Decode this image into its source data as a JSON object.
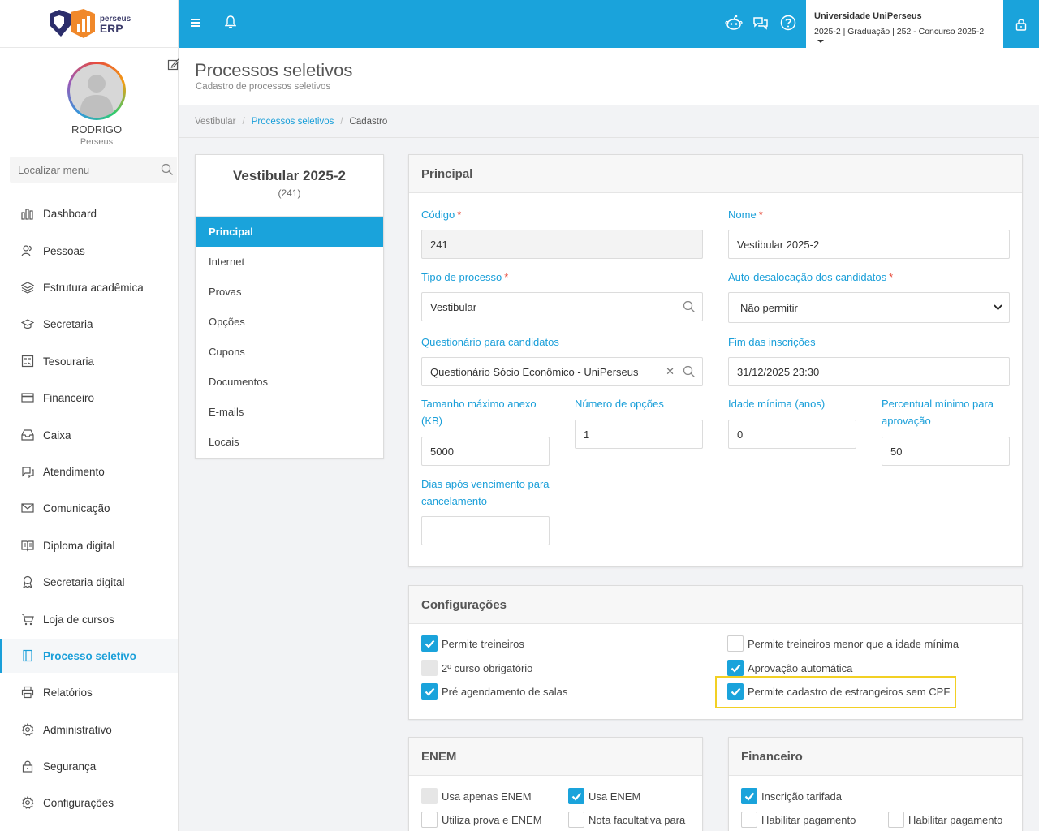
{
  "app": {
    "logo_line1": "perseus",
    "logo_line2": "ERP"
  },
  "user": {
    "name": "RODRIGO",
    "org": "Perseus"
  },
  "menu_search": {
    "placeholder": "Localizar menu"
  },
  "menu": [
    {
      "label": "Dashboard",
      "icon": "chart-icon"
    },
    {
      "label": "Pessoas",
      "icon": "people-icon"
    },
    {
      "label": "Estrutura acadêmica",
      "icon": "layers-icon"
    },
    {
      "label": "Secretaria",
      "icon": "graduation-cap-icon"
    },
    {
      "label": "Tesouraria",
      "icon": "calculator-icon"
    },
    {
      "label": "Financeiro",
      "icon": "credit-card-icon"
    },
    {
      "label": "Caixa",
      "icon": "inbox-icon"
    },
    {
      "label": "Atendimento",
      "icon": "chat-icon"
    },
    {
      "label": "Comunicação",
      "icon": "envelope-icon"
    },
    {
      "label": "Diploma digital",
      "icon": "book-icon"
    },
    {
      "label": "Secretaria digital",
      "icon": "award-icon"
    },
    {
      "label": "Loja de cursos",
      "icon": "cart-icon"
    },
    {
      "label": "Processo seletivo",
      "icon": "notebook-icon",
      "active": true
    },
    {
      "label": "Relatórios",
      "icon": "printer-icon"
    },
    {
      "label": "Administrativo",
      "icon": "gear-icon"
    },
    {
      "label": "Segurança",
      "icon": "lock-icon"
    },
    {
      "label": "Configurações",
      "icon": "gear-icon"
    }
  ],
  "institution": {
    "name": "Universidade UniPerseus",
    "context": "2025-2 | Graduação | 252 - Concurso 2025-2"
  },
  "header": {
    "title": "Processos seletivos",
    "subtitle": "Cadastro de processos seletivos"
  },
  "breadcrumb": [
    "Vestibular",
    "Processos seletivos",
    "Cadastro"
  ],
  "side_card": {
    "title": "Vestibular 2025-2",
    "code": "(241)",
    "tabs": [
      "Principal",
      "Internet",
      "Provas",
      "Opções",
      "Cupons",
      "Documentos",
      "E-mails",
      "Locais"
    ]
  },
  "principal": {
    "title": "Principal",
    "codigo_label": "Código",
    "codigo_value": "241",
    "nome_label": "Nome",
    "nome_value": "Vestibular 2025-2",
    "tipo_label": "Tipo de processo",
    "tipo_value": "Vestibular",
    "auto_label": "Auto-desalocação dos candidatos",
    "auto_value": "Não permitir",
    "quest_label": "Questionário para candidatos",
    "quest_value": "Questionário Sócio Econômico - UniPerseus",
    "fim_label": "Fim das inscrições",
    "fim_value": "31/12/2025 23:30",
    "tam_label_1": "Tamanho máximo anexo",
    "tam_label_2": "(KB)",
    "tam_value": "5000",
    "num_label": "Número de opções",
    "num_value": "1",
    "idade_label": "Idade mínima (anos)",
    "idade_value": "0",
    "perc_label_1": "Percentual mínimo para",
    "perc_label_2": "aprovação",
    "perc_value": "50",
    "dias_label_1": "Dias após vencimento para",
    "dias_label_2": "cancelamento",
    "dias_value": ""
  },
  "config": {
    "title": "Configurações",
    "items": [
      {
        "label": "Permite treineiros",
        "state": "checked"
      },
      {
        "label": "2º curso obrigatório",
        "state": "disabled"
      },
      {
        "label": "Pré agendamento de salas",
        "state": "checked"
      },
      {
        "label": "Permite treineiros menor que a idade mínima",
        "state": "unchecked"
      },
      {
        "label": "Aprovação automática",
        "state": "checked"
      },
      {
        "label": "Permite cadastro de estrangeiros sem CPF",
        "state": "checked"
      }
    ]
  },
  "enem": {
    "title": "ENEM",
    "items": [
      {
        "label": "Usa apenas ENEM",
        "state": "disabled"
      },
      {
        "label": "Usa ENEM",
        "state": "checked"
      },
      {
        "label": "Utiliza prova e ENEM",
        "state": "unchecked"
      },
      {
        "label": "Nota facultativa para",
        "state": "unchecked"
      }
    ]
  },
  "financeiro": {
    "title": "Financeiro",
    "items": [
      {
        "label": "Inscrição tarifada",
        "state": "checked"
      },
      {
        "label": "Habilitar pagamento",
        "state": "unchecked"
      },
      {
        "label": "Habilitar pagamento",
        "state": "unchecked"
      }
    ]
  },
  "colors": {
    "accent": "#1aa3db",
    "required": "#e74c3c",
    "highlight": "#f2d024"
  }
}
